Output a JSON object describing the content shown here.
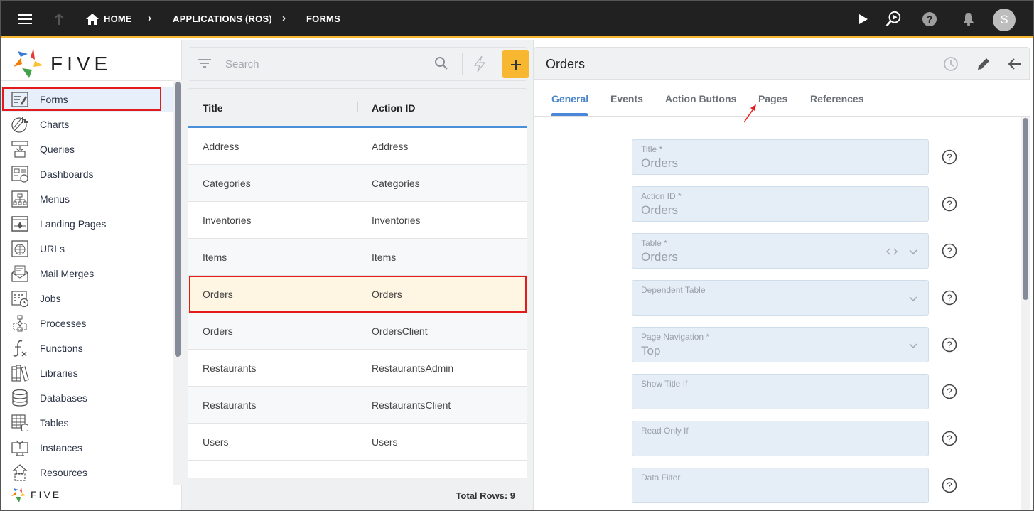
{
  "topbar": {
    "breadcrumbs": [
      "HOME",
      "APPLICATIONS (ROS)",
      "FORMS"
    ],
    "user_initial": "S",
    "accent_color": "#f7b731"
  },
  "sidebar": {
    "brand": "FIVE",
    "items": [
      {
        "label": "Forms",
        "icon": "forms-icon",
        "active": true
      },
      {
        "label": "Charts",
        "icon": "charts-icon"
      },
      {
        "label": "Queries",
        "icon": "queries-icon"
      },
      {
        "label": "Dashboards",
        "icon": "dashboards-icon"
      },
      {
        "label": "Menus",
        "icon": "menus-icon"
      },
      {
        "label": "Landing Pages",
        "icon": "landing-pages-icon"
      },
      {
        "label": "URLs",
        "icon": "urls-icon"
      },
      {
        "label": "Mail Merges",
        "icon": "mail-merges-icon"
      },
      {
        "label": "Jobs",
        "icon": "jobs-icon"
      },
      {
        "label": "Processes",
        "icon": "processes-icon"
      },
      {
        "label": "Functions",
        "icon": "functions-icon"
      },
      {
        "label": "Libraries",
        "icon": "libraries-icon"
      },
      {
        "label": "Databases",
        "icon": "databases-icon"
      },
      {
        "label": "Tables",
        "icon": "tables-icon"
      },
      {
        "label": "Instances",
        "icon": "instances-icon"
      },
      {
        "label": "Resources",
        "icon": "resources-icon"
      }
    ]
  },
  "list": {
    "search_placeholder": "Search",
    "columns": [
      "Title",
      "Action ID"
    ],
    "rows": [
      [
        "Address",
        "Address"
      ],
      [
        "Categories",
        "Categories"
      ],
      [
        "Inventories",
        "Inventories"
      ],
      [
        "Items",
        "Items"
      ],
      [
        "Orders",
        "Orders"
      ],
      [
        "Orders",
        "OrdersClient"
      ],
      [
        "Restaurants",
        "RestaurantsAdmin"
      ],
      [
        "Restaurants",
        "RestaurantsClient"
      ],
      [
        "Users",
        "Users"
      ]
    ],
    "selected_row": 4,
    "total_rows": "Total Rows: 9"
  },
  "detail": {
    "title": "Orders",
    "tabs": [
      "General",
      "Events",
      "Action Buttons",
      "Pages",
      "References"
    ],
    "active_tab": 0,
    "fields": [
      {
        "label": "Title *",
        "value": "Orders"
      },
      {
        "label": "Action ID *",
        "value": "Orders"
      },
      {
        "label": "Table *",
        "value": "Orders"
      },
      {
        "label": "Dependent Table",
        "value": ""
      },
      {
        "label": "Page Navigation *",
        "value": "Top"
      },
      {
        "label": "Show Title If",
        "value": ""
      },
      {
        "label": "Read Only If",
        "value": ""
      },
      {
        "label": "Data Filter",
        "value": ""
      }
    ]
  }
}
